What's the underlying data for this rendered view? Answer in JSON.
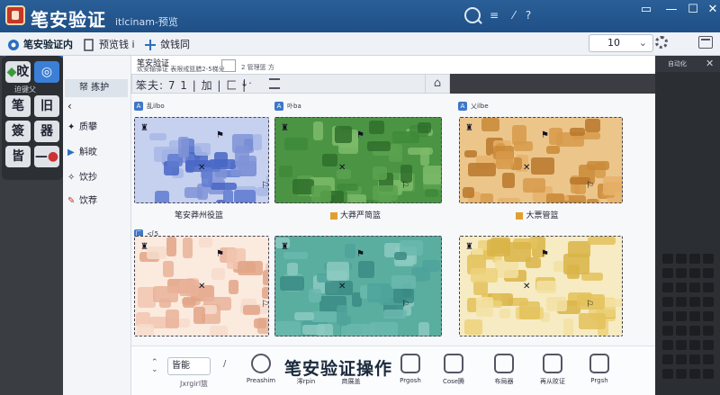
{
  "window": {
    "title": "笔安验证",
    "subtitle": "itlcinam-预览",
    "controls": [
      "▭",
      "—",
      "☐",
      "✕"
    ]
  },
  "tabs": [
    {
      "label": "笔安验证内",
      "active": true
    },
    {
      "label": "预览钱 i",
      "active": false
    },
    {
      "label": "敛钱同",
      "active": false
    }
  ],
  "zoom": {
    "value": "10"
  },
  "palette": {
    "rows": [
      [
        "旼",
        ""
      ],
      [
        "笔",
        "旧"
      ],
      [
        "簽",
        "器"
      ],
      [
        "皆",
        "—"
      ]
    ],
    "caption": "迫键父"
  },
  "sidebar": {
    "items": [
      {
        "label": "帑 拣护",
        "selected": true
      },
      {
        "label": "",
        "selected": false
      },
      {
        "label": "质攀",
        "selected": false
      },
      {
        "label": "斛旼",
        "selected": false
      },
      {
        "label": "饮抄",
        "selected": false
      },
      {
        "label": "饮荐",
        "selected": false
      }
    ]
  },
  "main_header": {
    "title": "笔安验证",
    "subtitle": "欢安输驿证 表限戒篮腊2-5梯分",
    "subtitle2": "2 管理篮 方"
  },
  "filterbar": {
    "text": "笨夫: 7 1 | 加 | 匚 |",
    "arrow": "↓·",
    "home": "⌂"
  },
  "cards": [
    {
      "tag_icon": "A",
      "tag": "乱ilbo",
      "label": "笔安莽州役篮",
      "color": "blue"
    },
    {
      "tag_icon": "A",
      "tag": "卟ba",
      "label": "大莽严简篮",
      "color": "green"
    },
    {
      "tag_icon": "A",
      "tag": "乂ilbe",
      "label": "大票管篮",
      "color": "orange"
    },
    {
      "tag_icon": "匚",
      "tag": "<[5",
      "label": "",
      "color": "peach"
    },
    {
      "tag_icon": "",
      "tag": "",
      "label": "",
      "color": "teal"
    },
    {
      "tag_icon": "",
      "tag": "",
      "label": "",
      "color": "yellow"
    }
  ],
  "actionbar": {
    "input_value": "皆能",
    "caption": "Jxrgirl篮",
    "title": "笔安验证操作",
    "tools": [
      {
        "label": "Preashim",
        "icon": "stop-icon"
      },
      {
        "label": "澪rpin",
        "icon": "blank-icon"
      },
      {
        "label": "商展盖",
        "icon": "blank-icon"
      },
      {
        "label": "Prgosh",
        "icon": "blank-icon"
      },
      {
        "label": "Cose腾",
        "icon": "dice-icon"
      },
      {
        "label": "布局器",
        "icon": "box-icon"
      },
      {
        "label": "再从旼证",
        "icon": "panel-icon"
      },
      {
        "label": "Prgsh",
        "icon": "smile-icon"
      }
    ]
  },
  "rightpane": {
    "label": "自动化",
    "close": "✕"
  }
}
